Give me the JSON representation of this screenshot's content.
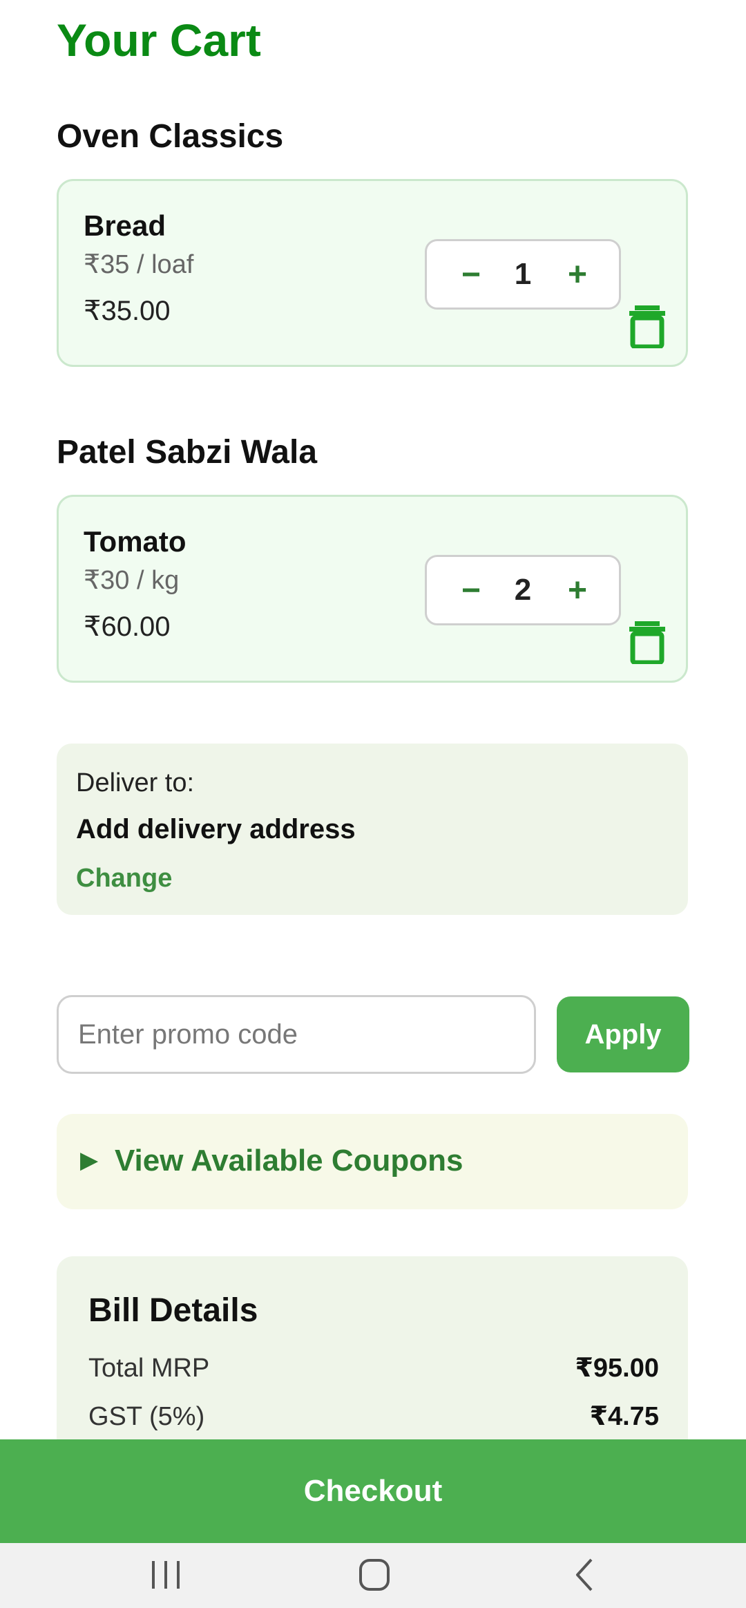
{
  "page": {
    "title": "Your Cart"
  },
  "stores": [
    {
      "name": "Oven Classics",
      "items": [
        {
          "name": "Bread",
          "unit_price": "₹35 / loaf",
          "line_total": "₹35.00",
          "quantity": "1"
        }
      ]
    },
    {
      "name": "Patel Sabzi Wala",
      "items": [
        {
          "name": "Tomato",
          "unit_price": "₹30 / kg",
          "line_total": "₹60.00",
          "quantity": "2"
        }
      ]
    }
  ],
  "stepper": {
    "minus": "−",
    "plus": "+"
  },
  "delivery": {
    "label": "Deliver to:",
    "address": "Add delivery address",
    "change": "Change"
  },
  "promo": {
    "placeholder": "Enter promo code",
    "value": "",
    "apply": "Apply"
  },
  "coupons": {
    "arrow": "▶",
    "label": "View Available Coupons"
  },
  "bill": {
    "title": "Bill Details",
    "rows": [
      {
        "label": "Total MRP",
        "value": "₹95.00"
      },
      {
        "label": "GST (5%)",
        "value": "₹4.75"
      }
    ]
  },
  "checkout": {
    "label": "Checkout"
  },
  "navigation": {
    "recents_icon": "recents-icon",
    "home_icon": "home-icon",
    "back_icon": "back-icon"
  },
  "colors": {
    "brand_green": "#0a8a14",
    "button_green": "#4caf50",
    "link_green": "#3e8e41",
    "card_background": "#f1fcf1",
    "info_background": "#eff5e9"
  }
}
